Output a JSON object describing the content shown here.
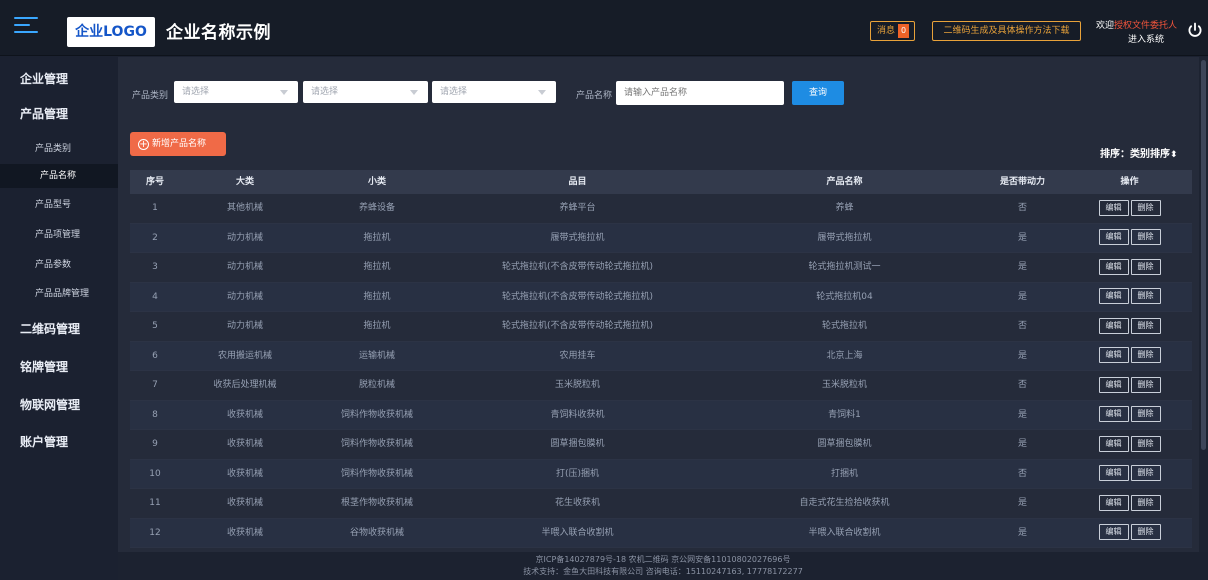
{
  "header": {
    "logo": "企业LOGO",
    "company": "企业名称示例",
    "msg_label": "消息",
    "msg_count": "0",
    "qr_button": "二维码生成及具体操作方法下载",
    "welcome": "欢迎",
    "user": "授权文件委托人",
    "enter": "进入系统"
  },
  "sidebar": {
    "sections": [
      "企业管理",
      "产品管理",
      "二维码管理",
      "铭牌管理",
      "物联网管理",
      "账户管理"
    ],
    "subitems": [
      "产品类别",
      "产品名称",
      "产品型号",
      "产品项管理",
      "产品参数",
      "产品品牌管理"
    ]
  },
  "filters": {
    "category_label": "产品类别",
    "select1": "请选择",
    "select2": "请选择",
    "select3": "请选择",
    "name_label": "产品名称",
    "name_placeholder": "请输入产品名称",
    "search": "查询"
  },
  "toolbar": {
    "add": "新增产品名称",
    "sort": "排序：类别排序"
  },
  "table": {
    "headers": [
      "序号",
      "大类",
      "小类",
      "品目",
      "产品名称",
      "是否带动力",
      "操作"
    ],
    "edit": "编辑",
    "delete": "删除",
    "rows": [
      [
        "1",
        "其他机械",
        "养蜂设备",
        "养蜂平台",
        "养蜂",
        "否"
      ],
      [
        "2",
        "动力机械",
        "拖拉机",
        "履带式拖拉机",
        "履带式拖拉机",
        "是"
      ],
      [
        "3",
        "动力机械",
        "拖拉机",
        "轮式拖拉机(不含皮带传动轮式拖拉机)",
        "轮式拖拉机测试一",
        "是"
      ],
      [
        "4",
        "动力机械",
        "拖拉机",
        "轮式拖拉机(不含皮带传动轮式拖拉机)",
        "轮式拖拉机04",
        "是"
      ],
      [
        "5",
        "动力机械",
        "拖拉机",
        "轮式拖拉机(不含皮带传动轮式拖拉机)",
        "轮式拖拉机",
        "否"
      ],
      [
        "6",
        "农用搬运机械",
        "运输机械",
        "农用挂车",
        "北京上海",
        "是"
      ],
      [
        "7",
        "收获后处理机械",
        "脱粒机械",
        "玉米脱粒机",
        "玉米脱粒机",
        "否"
      ],
      [
        "8",
        "收获机械",
        "饲料作物收获机械",
        "青饲料收获机",
        "青饲料1",
        "是"
      ],
      [
        "9",
        "收获机械",
        "饲料作物收获机械",
        "圆草捆包膜机",
        "圆草捆包膜机",
        "是"
      ],
      [
        "10",
        "收获机械",
        "饲料作物收获机械",
        "打(压)捆机",
        "打捆机",
        "否"
      ],
      [
        "11",
        "收获机械",
        "根茎作物收获机械",
        "花生收获机",
        "自走式花生捡拾收获机",
        "是"
      ],
      [
        "12",
        "收获机械",
        "谷物收获机械",
        "半喂入联合收割机",
        "半喂入联合收割机",
        "是"
      ]
    ]
  },
  "footer": {
    "line1": "京ICP备14027879号-18 农机二维码 京公网安备11010802027696号",
    "line2": "技术支持：金鱼大田科技有限公司    咨询电话：15110247163, 17778172277"
  }
}
